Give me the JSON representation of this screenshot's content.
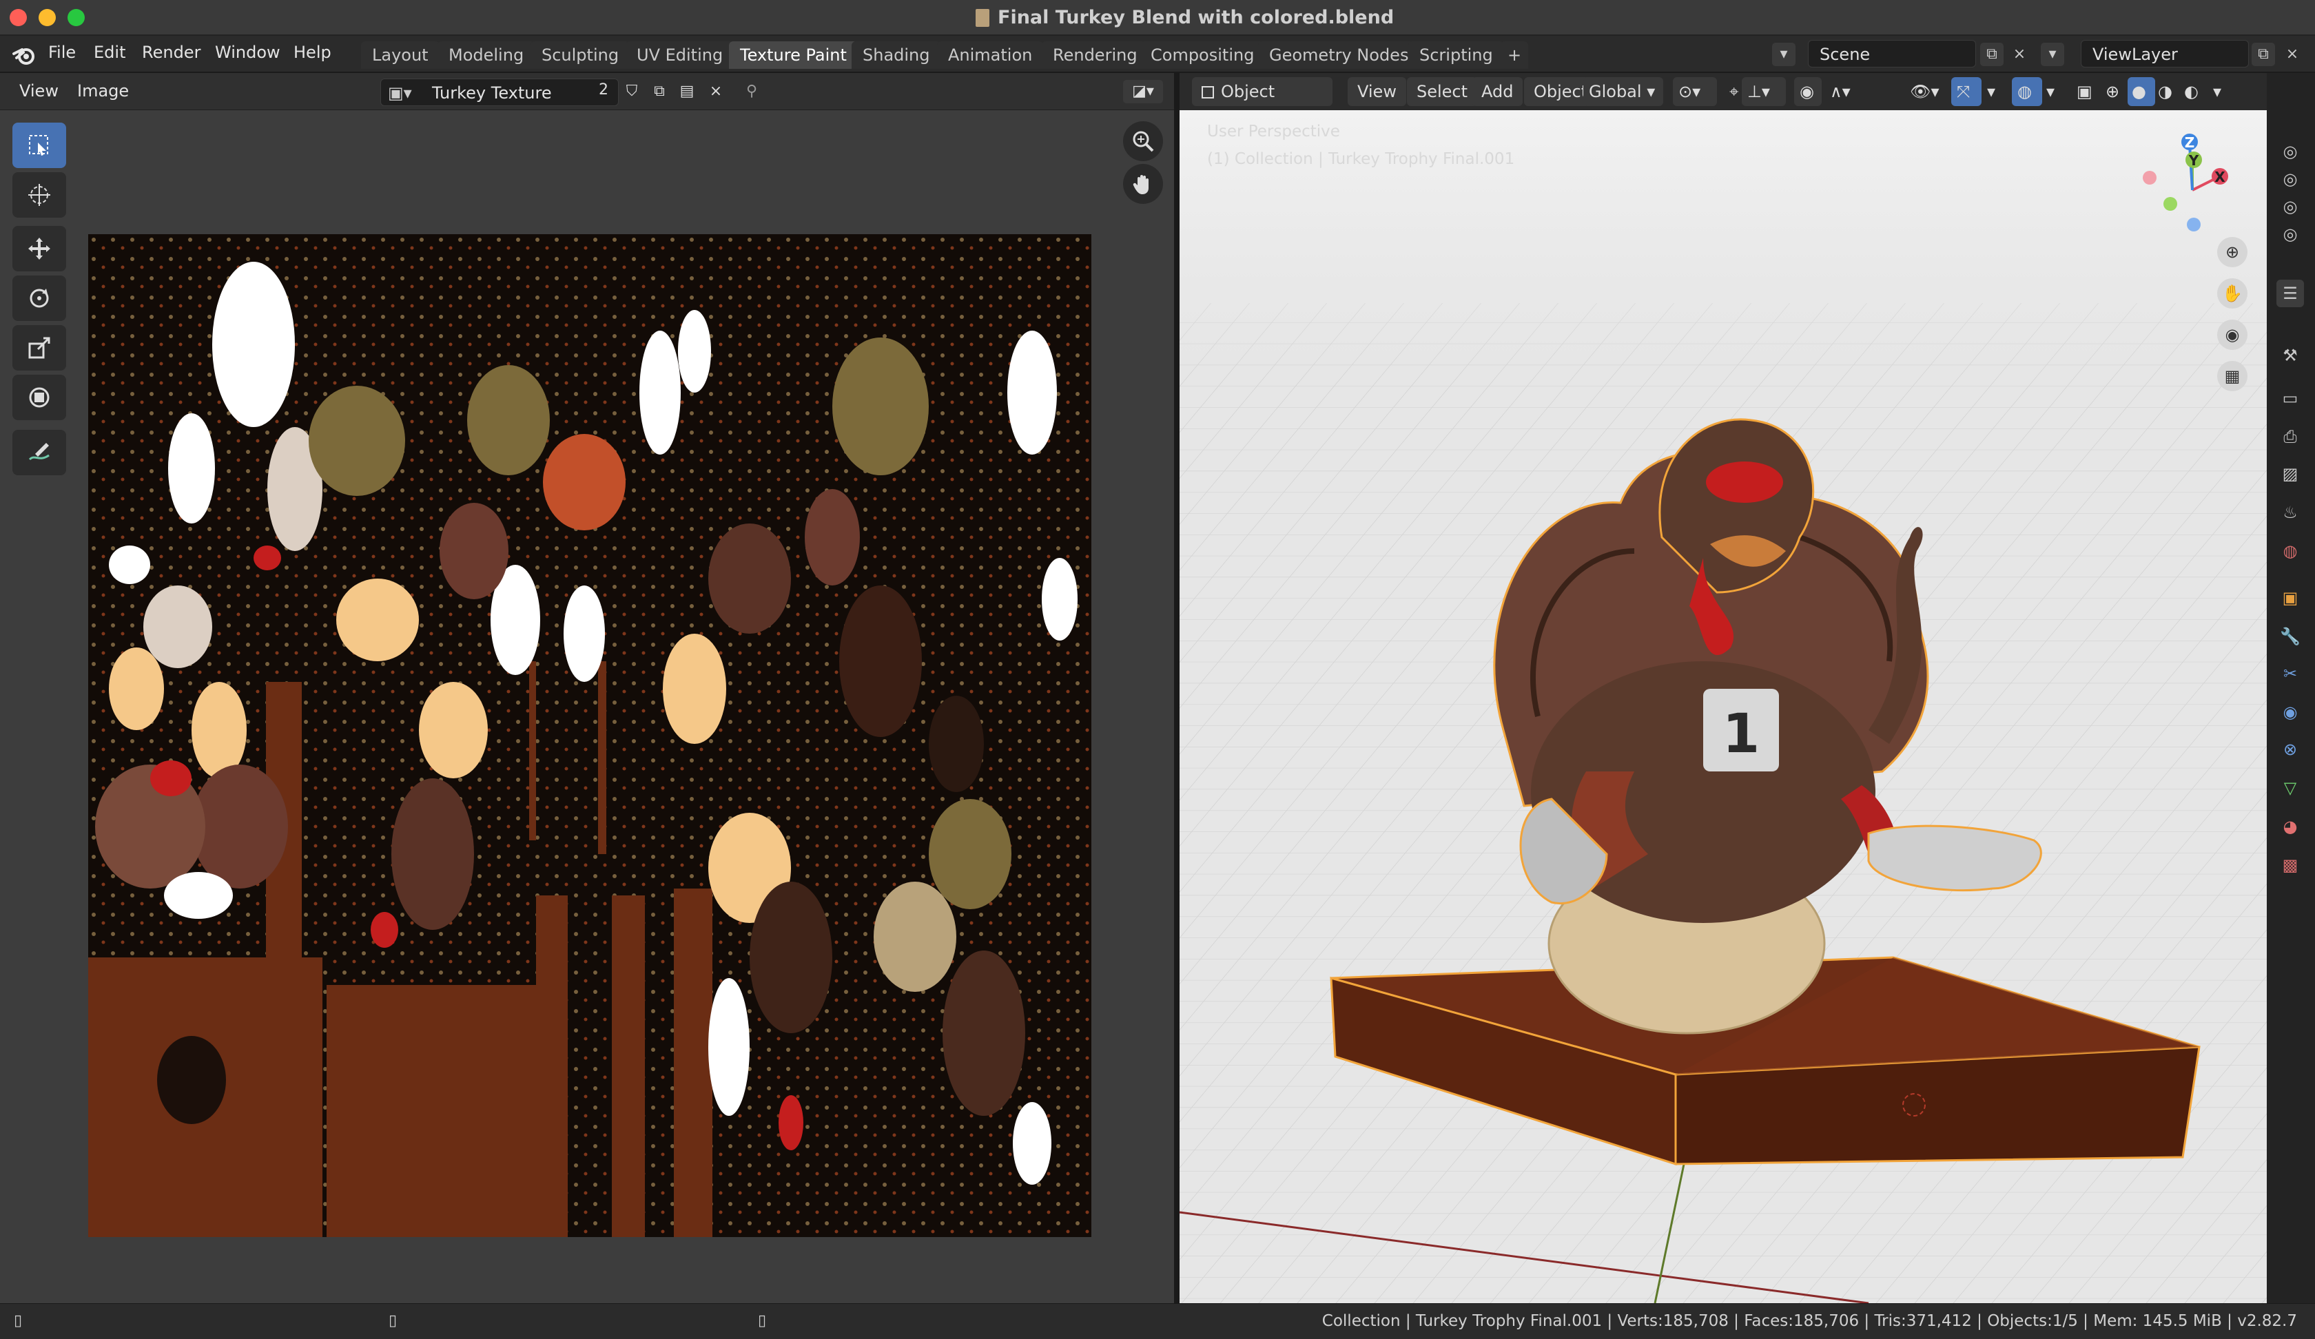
{
  "window": {
    "title": "Final Turkey Blend with colored.blend"
  },
  "menu": [
    "File",
    "Edit",
    "Render",
    "Window",
    "Help"
  ],
  "workspaces": [
    "Layout",
    "Modeling",
    "Sculpting",
    "UV Editing",
    "Texture Paint",
    "Shading",
    "Animation",
    "Rendering",
    "Compositing",
    "Geometry Nodes",
    "Scripting"
  ],
  "active_workspace": "Texture Paint",
  "add_workspace": "+",
  "scene": {
    "label": "Scene"
  },
  "view_layer": {
    "label": "ViewLayer"
  },
  "image_editor": {
    "menus": [
      "View",
      "Image"
    ],
    "image_name": "Turkey Texture",
    "users": "2"
  },
  "viewport": {
    "mode": "Object Mode",
    "menus": [
      "View",
      "Select",
      "Add",
      "Object"
    ],
    "transform_orientation": "Global",
    "info_perspective": "User Perspective",
    "info_collection": "(1) Collection | Turkey Trophy Final.001",
    "badge_number": "1"
  },
  "gizmo_axes": [
    "X",
    "Y",
    "Z"
  ],
  "status_bar": "Collection | Turkey Trophy Final.001 | Verts:185,708 | Faces:185,706 | Tris:371,412 | Objects:1/5 | Mem: 145.5 MiB | v2.82.7",
  "colors": {
    "accent_blue": "#4772b3",
    "texture_brown": "#6b2d14",
    "selection_orange": "#f2a43a",
    "turkey_red": "#c41e1e"
  }
}
